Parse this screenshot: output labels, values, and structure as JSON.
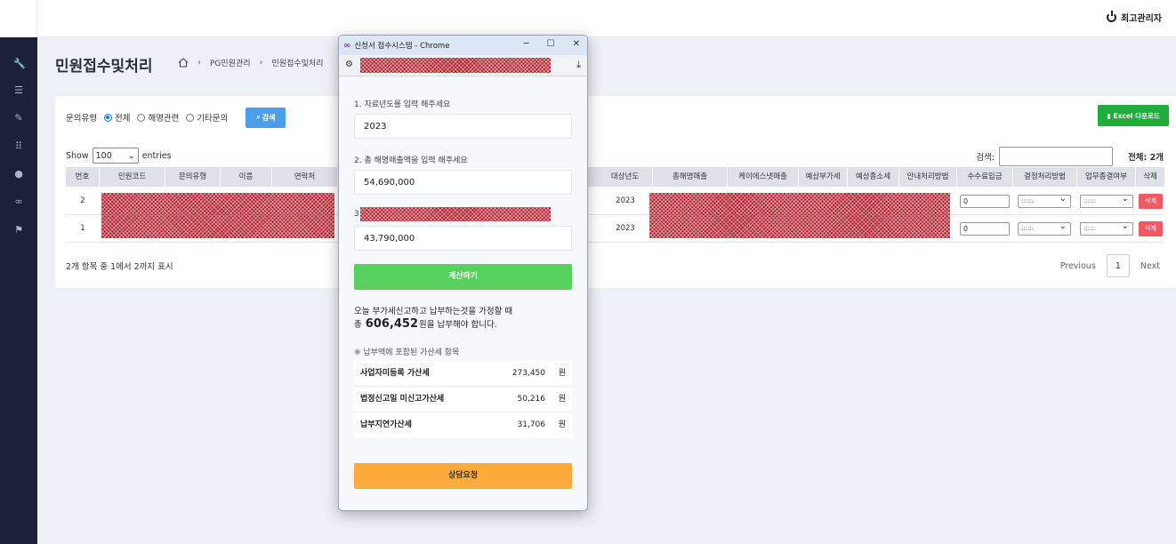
{
  "header": {
    "user_label": "최고관리자"
  },
  "page": {
    "title": "민원접수및처리",
    "breadcrumb": [
      "PG민원관리",
      "민원접수및처리"
    ]
  },
  "filter": {
    "label": "문의유형",
    "options": [
      "전체",
      "해명관련",
      "기타문의"
    ],
    "selected": "전체",
    "search_button": "검색",
    "excel_button": "Excel 다운로드"
  },
  "table_controls": {
    "show_prefix": "Show",
    "page_size": "100",
    "show_suffix": "entries",
    "search_label": "검색:",
    "total": "전체: 2개"
  },
  "table": {
    "columns": [
      "번호",
      "민원코드",
      "문의유형",
      "이름",
      "연락처",
      "대상년도",
      "총해명매출",
      "케이에스넷매출",
      "예상부가세",
      "예상종소세",
      "안내처리방법",
      "수수료입금",
      "결정처리방법",
      "업무종결여부",
      "삭제"
    ],
    "rows": [
      {
        "no": "2",
        "year": "2023",
        "fee": "0",
        "decision": "::::::",
        "closed": "::::::",
        "delete": "삭제"
      },
      {
        "no": "1",
        "year": "2023",
        "fee": "0",
        "decision": "::::::",
        "closed": "::::::",
        "delete": "삭제"
      }
    ],
    "summary": "2개 항목 중 1에서 2까지 표시",
    "pager": {
      "prev": "Previous",
      "current": "1",
      "next": "Next"
    }
  },
  "popup": {
    "window_title": "신청서 접수시스템 - Chrome",
    "q1": "1. 자료년도를 입력 해주세요",
    "v1": "2023",
    "q2": "2. 총 해명매출액을 입력 해주세요",
    "v2": "54,690,000",
    "q3_prefix": "3",
    "v3": "43,790,000",
    "calc_button": "계산하기",
    "result_line1": "오늘 부가세신고하고 납부하는것을 가정할 때",
    "result_prefix": "총",
    "result_amount": "606,452",
    "result_suffix": "원을 납부해야 합니다.",
    "note": "※ 납부액에 포함된 가산세 항목",
    "items": [
      {
        "name": "사업자미등록 가산세",
        "amount": "273,450",
        "unit": "원"
      },
      {
        "name": "법정신고일 미신고가산세",
        "amount": "50,216",
        "unit": "원"
      },
      {
        "name": "납부지연가산세",
        "amount": "31,706",
        "unit": "원"
      }
    ],
    "consult_button": "상담요청"
  }
}
